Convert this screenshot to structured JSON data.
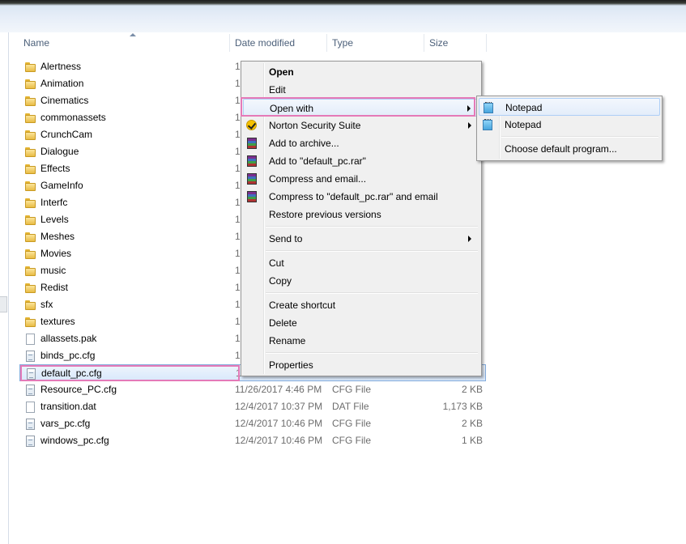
{
  "header": {
    "name": "Name",
    "date_modified": "Date modified",
    "type": "Type",
    "size": "Size"
  },
  "files": [
    {
      "name": "Alertness",
      "date": "1",
      "type": "",
      "size": "",
      "icon": "folder-icon"
    },
    {
      "name": "Animation",
      "date": "1",
      "type": "",
      "size": "",
      "icon": "folder-icon"
    },
    {
      "name": "Cinematics",
      "date": "1",
      "type": "",
      "size": "",
      "icon": "folder-icon"
    },
    {
      "name": "commonassets",
      "date": "1",
      "type": "",
      "size": "",
      "icon": "folder-icon"
    },
    {
      "name": "CrunchCam",
      "date": "1",
      "type": "",
      "size": "",
      "icon": "folder-icon"
    },
    {
      "name": "Dialogue",
      "date": "1",
      "type": "",
      "size": "",
      "icon": "folder-icon"
    },
    {
      "name": "Effects",
      "date": "1",
      "type": "",
      "size": "",
      "icon": "folder-icon"
    },
    {
      "name": "GameInfo",
      "date": "1",
      "type": "",
      "size": "",
      "icon": "folder-icon"
    },
    {
      "name": "Interfc",
      "date": "1",
      "type": "",
      "size": "",
      "icon": "folder-icon"
    },
    {
      "name": "Levels",
      "date": "1",
      "type": "",
      "size": "",
      "icon": "folder-icon"
    },
    {
      "name": "Meshes",
      "date": "1",
      "type": "",
      "size": "",
      "icon": "folder-icon"
    },
    {
      "name": "Movies",
      "date": "1",
      "type": "",
      "size": "",
      "icon": "folder-icon"
    },
    {
      "name": "music",
      "date": "1",
      "type": "",
      "size": "",
      "icon": "folder-icon"
    },
    {
      "name": "Redist",
      "date": "1",
      "type": "",
      "size": "",
      "icon": "folder-icon"
    },
    {
      "name": "sfx",
      "date": "1",
      "type": "",
      "size": "",
      "icon": "folder-icon"
    },
    {
      "name": "textures",
      "date": "1",
      "type": "",
      "size": "",
      "icon": "folder-icon"
    },
    {
      "name": "allassets.pak",
      "date": "1",
      "type": "",
      "size": "",
      "icon": "file-icon"
    },
    {
      "name": "binds_pc.cfg",
      "date": "1",
      "type": "",
      "size": "",
      "icon": "cfg-icon"
    },
    {
      "name": "default_pc.cfg",
      "date": "1",
      "type": "",
      "size": "",
      "icon": "cfg-icon",
      "selected": true
    },
    {
      "name": "Resource_PC.cfg",
      "date": "11/26/2017 4:46 PM",
      "type": "CFG File",
      "size": "2 KB",
      "icon": "cfg-icon"
    },
    {
      "name": "transition.dat",
      "date": "12/4/2017 10:37 PM",
      "type": "DAT File",
      "size": "1,173 KB",
      "icon": "file-icon"
    },
    {
      "name": "vars_pc.cfg",
      "date": "12/4/2017 10:46 PM",
      "type": "CFG File",
      "size": "2 KB",
      "icon": "cfg-icon"
    },
    {
      "name": "windows_pc.cfg",
      "date": "12/4/2017 10:46 PM",
      "type": "CFG File",
      "size": "1 KB",
      "icon": "cfg-icon"
    }
  ],
  "context_menu": {
    "open": "Open",
    "edit": "Edit",
    "open_with": "Open with",
    "norton": "Norton Security Suite",
    "add_archive": "Add to archive...",
    "add_rar": "Add to \"default_pc.rar\"",
    "compress_email": "Compress and email...",
    "compress_rar_email": "Compress to \"default_pc.rar\" and email",
    "restore": "Restore previous versions",
    "send_to": "Send to",
    "cut": "Cut",
    "copy": "Copy",
    "create_shortcut": "Create shortcut",
    "delete": "Delete",
    "rename": "Rename",
    "properties": "Properties"
  },
  "submenu": {
    "item1": "Notepad",
    "item2": "Notepad",
    "choose_default": "Choose default program..."
  },
  "colors": {
    "highlight": "#e57ab8",
    "selection": "#84acdd"
  }
}
